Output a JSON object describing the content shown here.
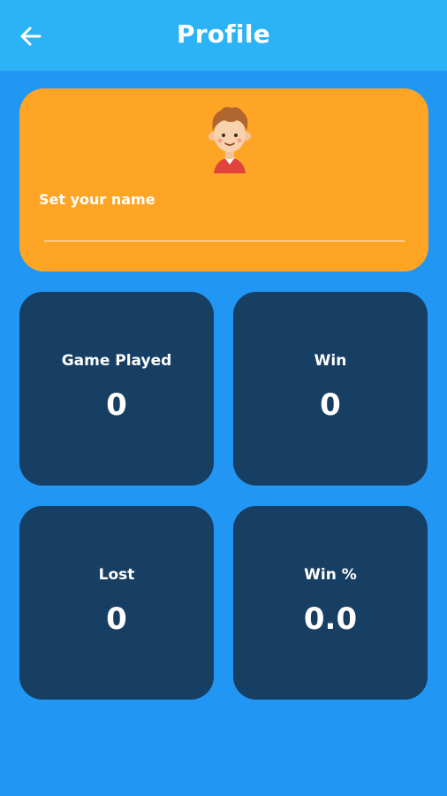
{
  "header": {
    "title": "Profile",
    "back_icon": "arrow-left-icon"
  },
  "profile": {
    "avatar_icon": "boy-avatar-icon",
    "name_label": "Set your name",
    "name_value": "",
    "name_placeholder": ""
  },
  "stats": [
    {
      "label": "Game Played",
      "value": "0"
    },
    {
      "label": "Win",
      "value": "0"
    },
    {
      "label": "Lost",
      "value": "0"
    },
    {
      "label": "Win %",
      "value": "0.0"
    }
  ],
  "colors": {
    "background": "#2196F3",
    "appbar": "#2CB3F5",
    "profile_card": "#FFA526",
    "stat_card": "#173E63",
    "text": "#FFFFFF"
  }
}
